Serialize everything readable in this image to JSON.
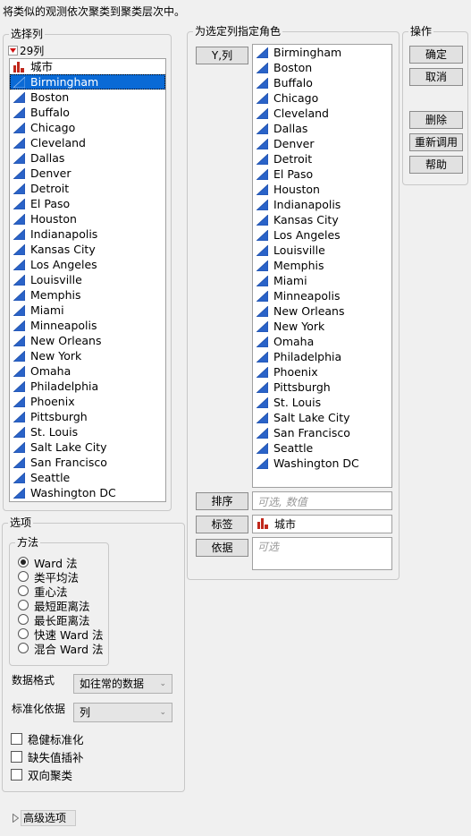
{
  "header": {
    "description": "将类似的观测依次聚类到聚类层次中。"
  },
  "select_columns": {
    "legend": "选择列",
    "count_label": "29列",
    "label_column": "城市",
    "columns": [
      "Birmingham",
      "Boston",
      "Buffalo",
      "Chicago",
      "Cleveland",
      "Dallas",
      "Denver",
      "Detroit",
      "El Paso",
      "Houston",
      "Indianapolis",
      "Kansas City",
      "Los Angeles",
      "Louisville",
      "Memphis",
      "Miami",
      "Minneapolis",
      "New Orleans",
      "New York",
      "Omaha",
      "Philadelphia",
      "Phoenix",
      "Pittsburgh",
      "St. Louis",
      "Salt Lake City",
      "San Francisco",
      "Seattle",
      "Washington DC"
    ],
    "selected": "Birmingham"
  },
  "roles": {
    "legend": "为选定列指定角色",
    "y_button": "Y,列",
    "y_columns": [
      "Birmingham",
      "Boston",
      "Buffalo",
      "Chicago",
      "Cleveland",
      "Dallas",
      "Denver",
      "Detroit",
      "El Paso",
      "Houston",
      "Indianapolis",
      "Kansas City",
      "Los Angeles",
      "Louisville",
      "Memphis",
      "Miami",
      "Minneapolis",
      "New Orleans",
      "New York",
      "Omaha",
      "Philadelphia",
      "Phoenix",
      "Pittsburgh",
      "St. Louis",
      "Salt Lake City",
      "San Francisco",
      "Seattle",
      "Washington DC"
    ],
    "order_button": "排序",
    "order_placeholder": "可选, 数值",
    "label_button": "标签",
    "label_value": "城市",
    "by_button": "依据",
    "by_placeholder": "可选"
  },
  "actions": {
    "legend": "操作",
    "ok": "确定",
    "cancel": "取消",
    "remove": "删除",
    "recall": "重新调用",
    "help": "帮助"
  },
  "options": {
    "legend": "选项",
    "method_legend": "方法",
    "methods": [
      "Ward 法",
      "类平均法",
      "重心法",
      "最短距离法",
      "最长距离法",
      "快速 Ward 法",
      "混合 Ward 法"
    ],
    "selected_method": 0,
    "data_format_label": "数据格式",
    "data_format_value": "如往常的数据",
    "standardize_label": "标准化依据",
    "standardize_value": "列",
    "checkboxes": [
      {
        "label": "稳健标准化",
        "checked": false
      },
      {
        "label": "缺失值插补",
        "checked": false
      },
      {
        "label": "双向聚类",
        "checked": false
      }
    ]
  },
  "advanced": {
    "label": "高级选项"
  },
  "colors": {
    "selection": "#0a6ad6",
    "continuous_icon": "#2a63c8",
    "nominal_icon": "#c0281c"
  }
}
